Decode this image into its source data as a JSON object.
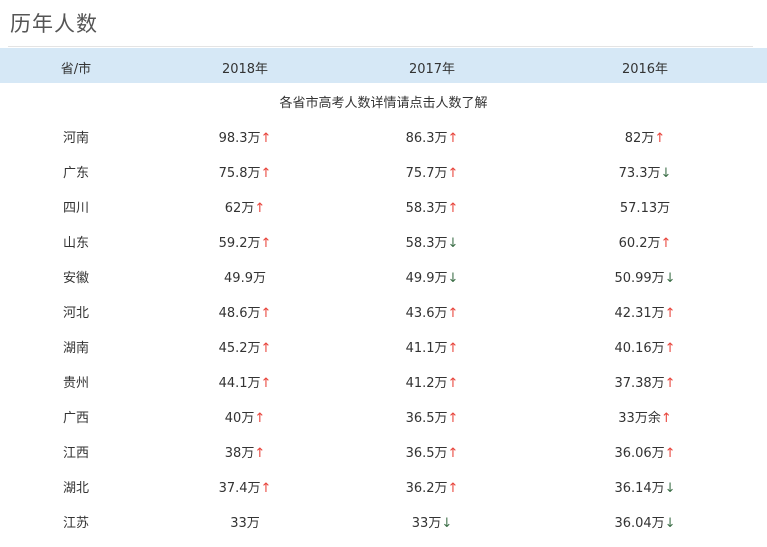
{
  "title": "历年人数",
  "headers": [
    "省/市",
    "2018年",
    "2017年",
    "2016年"
  ],
  "note": "各省市高考人数详情请点击人数了解",
  "colors": {
    "up": "#e8453c",
    "down": "#3c6e47",
    "header_bg": "#d6e8f6"
  },
  "rows": [
    {
      "province": "河南",
      "values": [
        {
          "v": "98.3万",
          "t": "up"
        },
        {
          "v": "86.3万",
          "t": "up"
        },
        {
          "v": "82万",
          "t": "up"
        }
      ]
    },
    {
      "province": "广东",
      "values": [
        {
          "v": "75.8万",
          "t": "up"
        },
        {
          "v": "75.7万",
          "t": "up"
        },
        {
          "v": "73.3万",
          "t": "down"
        }
      ]
    },
    {
      "province": "四川",
      "values": [
        {
          "v": "62万",
          "t": "up"
        },
        {
          "v": "58.3万",
          "t": "up"
        },
        {
          "v": "57.13万",
          "t": ""
        }
      ]
    },
    {
      "province": "山东",
      "values": [
        {
          "v": "59.2万",
          "t": "up"
        },
        {
          "v": "58.3万",
          "t": "down"
        },
        {
          "v": "60.2万",
          "t": "up"
        }
      ]
    },
    {
      "province": "安徽",
      "values": [
        {
          "v": "49.9万",
          "t": ""
        },
        {
          "v": "49.9万",
          "t": "down"
        },
        {
          "v": "50.99万",
          "t": "down"
        }
      ]
    },
    {
      "province": "河北",
      "values": [
        {
          "v": "48.6万",
          "t": "up"
        },
        {
          "v": "43.6万",
          "t": "up"
        },
        {
          "v": "42.31万",
          "t": "up"
        }
      ]
    },
    {
      "province": "湖南",
      "values": [
        {
          "v": "45.2万",
          "t": "up"
        },
        {
          "v": "41.1万",
          "t": "up"
        },
        {
          "v": "40.16万",
          "t": "up"
        }
      ]
    },
    {
      "province": "贵州",
      "values": [
        {
          "v": "44.1万",
          "t": "up"
        },
        {
          "v": "41.2万",
          "t": "up"
        },
        {
          "v": "37.38万",
          "t": "up"
        }
      ]
    },
    {
      "province": "广西",
      "values": [
        {
          "v": "40万",
          "t": "up"
        },
        {
          "v": "36.5万",
          "t": "up"
        },
        {
          "v": "33万余",
          "t": "up"
        }
      ]
    },
    {
      "province": "江西",
      "values": [
        {
          "v": "38万",
          "t": "up"
        },
        {
          "v": "36.5万",
          "t": "up"
        },
        {
          "v": "36.06万",
          "t": "up"
        }
      ]
    },
    {
      "province": "湖北",
      "values": [
        {
          "v": "37.4万",
          "t": "up"
        },
        {
          "v": "36.2万",
          "t": "up"
        },
        {
          "v": "36.14万",
          "t": "down"
        }
      ]
    },
    {
      "province": "江苏",
      "values": [
        {
          "v": "33万",
          "t": ""
        },
        {
          "v": "33万",
          "t": "down"
        },
        {
          "v": "36.04万",
          "t": "down"
        }
      ]
    }
  ],
  "arrows": {
    "up": "↑",
    "down": "↓"
  }
}
